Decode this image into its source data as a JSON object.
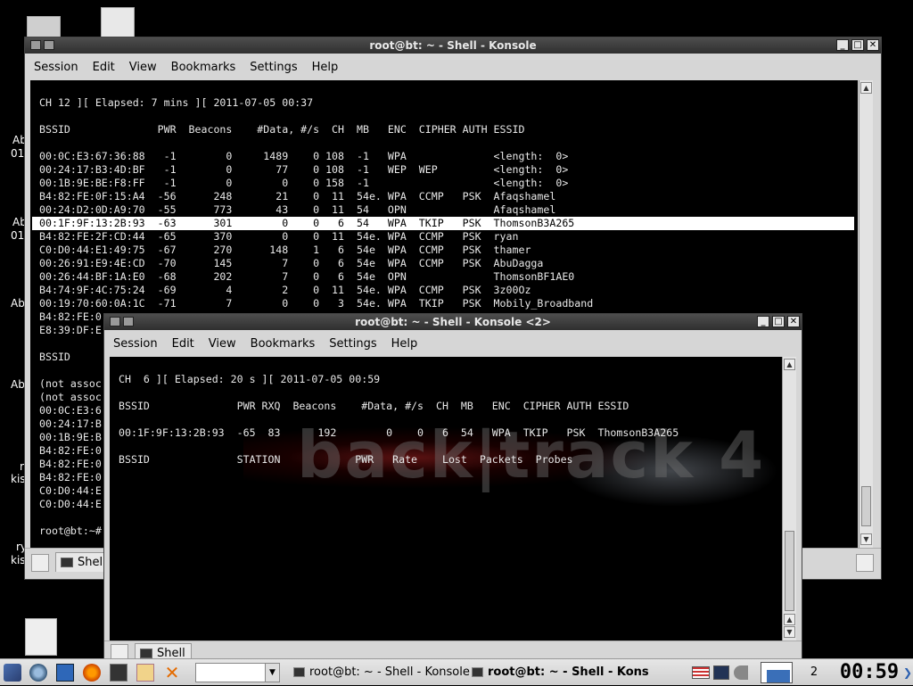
{
  "window1": {
    "title": "root@bt: ~ - Shell - Konsole",
    "menu": [
      "Session",
      "Edit",
      "View",
      "Bookmarks",
      "Settings",
      "Help"
    ],
    "lines": [
      "CH 12 ][ Elapsed: 7 mins ][ 2011-07-05 00:37",
      "",
      "BSSID              PWR  Beacons    #Data, #/s  CH  MB   ENC  CIPHER AUTH ESSID",
      "",
      "00:0C:E3:67:36:88   -1        0     1489    0 108  -1   WPA              <length:  0>",
      "00:24:17:B3:4D:BF   -1        0       77    0 108  -1   WEP  WEP         <length:  0>",
      "00:1B:9E:BE:F8:FF   -1        0        0    0 158  -1                    <length:  0>",
      "B4:82:FE:0F:15:A4  -56      248       21    0  11  54e. WPA  CCMP   PSK  Afaqshamel",
      "00:24:D2:0D:A9:70  -55      773       43    0  11  54   OPN              Afaqshamel",
      "00:1F:9F:13:2B:93  -63      301        0    0   6  54   WPA  TKIP   PSK  ThomsonB3A265",
      "B4:82:FE:2F:CD:44  -65      370        0    0  11  54e. WPA  CCMP   PSK  ryan",
      "C0:D0:44:E1:49:75  -67      270      148    1   6  54e  WPA  CCMP   PSK  thamer",
      "00:26:91:E9:4E:CD  -70      145        7    0   6  54e  WPA  CCMP   PSK  AbuDagga",
      "00:26:44:BF:1A:E0  -68      202        7    0   6  54e  OPN              ThomsonBF1AE0",
      "B4:74:9F:4C:75:24  -69        4        2    0  11  54e. WPA  CCMP   PSK  3z00Oz",
      "00:19:70:60:0A:1C  -71        7        0    0   3  54e. WPA  TKIP   PSK  Mobily_Broadband",
      "B4:82:FE:0",
      "E8:39:DF:E",
      "",
      "BSSID",
      "",
      "(not assoc",
      "(not assoc",
      "00:0C:E3:6",
      "00:24:17:B",
      "00:1B:9E:B",
      "B4:82:FE:0",
      "B4:82:FE:0",
      "B4:82:FE:0",
      "C0:D0:44:E",
      "C0:D0:44:E",
      "",
      "root@bt:~# "
    ],
    "tab_label": "Shel"
  },
  "window2": {
    "title": "root@bt: ~ - Shell - Konsole <2>",
    "menu": [
      "Session",
      "Edit",
      "View",
      "Bookmarks",
      "Settings",
      "Help"
    ],
    "lines": [
      "CH  6 ][ Elapsed: 20 s ][ 2011-07-05 00:59",
      "",
      "BSSID              PWR RXQ  Beacons    #Data, #/s  CH  MB   ENC  CIPHER AUTH ESSID",
      "",
      "00:1F:9F:13:2B:93  -65  83      192        0    0   6  54   WPA  TKIP   PSK  ThomsonB3A265",
      "",
      "BSSID              STATION            PWR   Rate    Lost  Packets  Probes"
    ],
    "tab_label": "Shell",
    "watermark": "back|track 4"
  },
  "desktop": {
    "labels": [
      "Ab",
      "01",
      "Ab",
      "01",
      "Ab",
      "Ab",
      "r",
      "kis",
      "ry",
      "kis"
    ]
  },
  "taskbar": {
    "tasks": [
      "root@bt: ~ - Shell - Konsole",
      "root@bt: ~ - Shell - Konso"
    ],
    "desktop_number": "2",
    "clock": "00:59"
  },
  "colors": {
    "terminal_bg": "#000000",
    "terminal_fg": "#e8e8e8",
    "highlight_bg": "#ffffff",
    "titlebar": "#3c3c3c"
  }
}
